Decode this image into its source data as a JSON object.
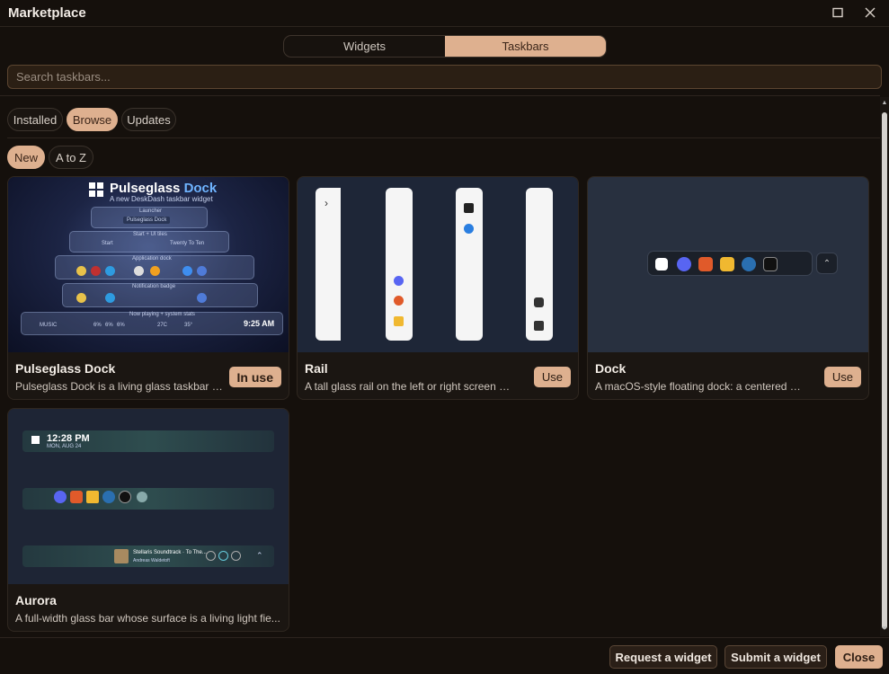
{
  "window": {
    "title": "Marketplace"
  },
  "mode_tabs": [
    {
      "label": "Widgets"
    },
    {
      "label": "Taskbars"
    }
  ],
  "search": {
    "placeholder": "Search taskbars..."
  },
  "filter_tabs": [
    {
      "label": "Installed"
    },
    {
      "label": "Browse"
    },
    {
      "label": "Updates"
    }
  ],
  "sort_tabs": [
    {
      "label": "New"
    },
    {
      "label": "A to Z"
    }
  ],
  "cards": [
    {
      "name": "Pulseglass Dock",
      "description": "Pulseglass Dock is a living glass taskbar fo...",
      "action": "In use",
      "preview": {
        "title_a": "Pulseglass",
        "title_b": "Dock",
        "subtitle": "A new DeskDash taskbar widget",
        "clock": "9:25 AM",
        "tiers": [
          "Launcher",
          "Start + UI tiles",
          "Application dock",
          "Notification badge",
          "Now playing + system stats"
        ],
        "launcher_label": "Pulseglass Dock",
        "start_label": "Start",
        "tile_label": "Twenty To Ten",
        "media": "MUSIC",
        "stats": [
          "6%",
          "6%",
          "6%",
          "27C"
        ],
        "temp": "35°"
      }
    },
    {
      "name": "Rail",
      "description": "A tall glass rail on the left or right screen ed...",
      "action": "Use",
      "preview": {
        "chevron": "›"
      }
    },
    {
      "name": "Dock",
      "description": "A macOS-style floating dock: a centered pill ...",
      "action": "Use",
      "preview": {
        "chevron": "⌃"
      }
    },
    {
      "name": "Aurora",
      "description": "A full-width glass bar whose surface is a living light fie...",
      "preview": {
        "time": "12:28 PM",
        "date": "MON, AUG 24",
        "track_title": "Stellaris Soundtrack · To The...",
        "track_artist": "Andreas Waldetoft"
      }
    }
  ],
  "footer": {
    "request_label": "Request a widget",
    "submit_label": "Submit a widget",
    "close_label": "Close"
  },
  "colors": {
    "accent": "#deb08f",
    "background": "#15100c",
    "card": "#1b1612",
    "search_bg": "#2b1f14"
  }
}
